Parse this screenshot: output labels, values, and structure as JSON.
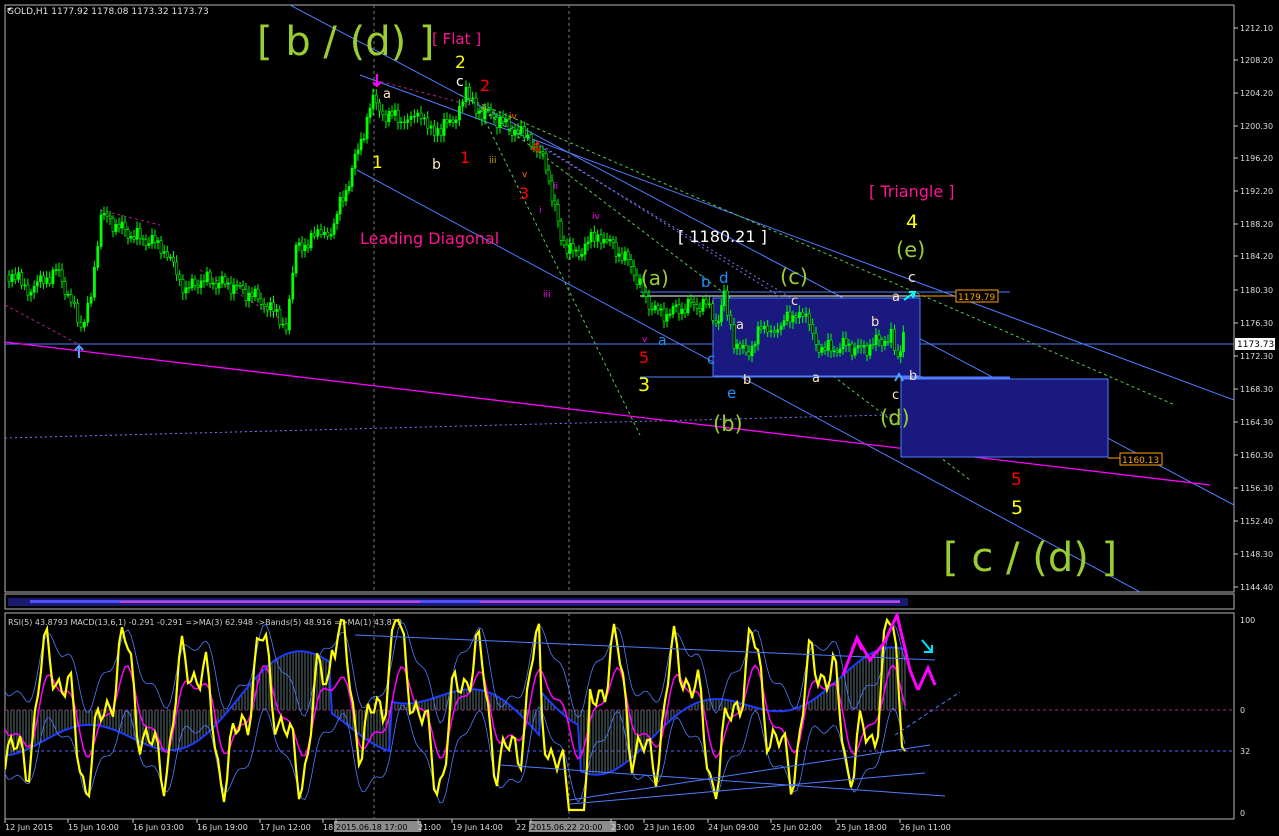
{
  "window": {
    "symbol_line": "GOLD,H1  1177.92 1178.08 1173.32 1173.73"
  },
  "indicator_header": "RSI(5) 43.8793  MACD(13,6,1) -0.291 -0.291  =>MA(3) 62.948  ->Bands(5) 48.916  =>MA(1) 43.879",
  "price_axis": {
    "ticks": [
      "1212.10",
      "1208.20",
      "1204.20",
      "1200.30",
      "1196.20",
      "1192.20",
      "1188.20",
      "1184.20",
      "1180.30",
      "1176.30",
      "1172.30",
      "1168.30",
      "1164.30",
      "1160.30",
      "1156.30",
      "1152.40",
      "1148.30",
      "1144.40"
    ],
    "current_price": "1173.73",
    "level_1179": "1179.79",
    "level_1160": "1160.13"
  },
  "indicator_axis": {
    "ticks": [
      "100",
      "0",
      "32",
      "0"
    ]
  },
  "time_axis": {
    "labels": [
      "12 Jun 2015",
      "15 Jun 10:00",
      "16 Jun 03:00",
      "16 Jun 19:00",
      "17 Jun 12:00",
      "18 Jun 05:00",
      "2015.06.18 17:00",
      "21:00",
      "19 Jun 14:00",
      "22 Jun 07:00",
      "2015.06.22 20:00",
      "23:00",
      "23 Jun 16:00",
      "24 Jun 09:00",
      "25 Jun 02:00",
      "25 Jun 18:00",
      "26 Jun 11:00"
    ]
  },
  "wave_labels": {
    "b_d": "[ b / (d) ]",
    "flat": "[ Flat ]",
    "wave2_yellow": "2",
    "c_top": "c",
    "wave2_red": "2",
    "a_top": "a",
    "one_yellow": "1",
    "b_low": "b",
    "one_red": "1",
    "ii": "ii",
    "iii_a": "iii",
    "iv_a": "iv",
    "four_red": "4",
    "v_a": "v",
    "three_red": "3",
    "i_a": "i",
    "ii_b": "ii",
    "iv_b": "iv",
    "iii_b": "iii",
    "leading_diagonal": "Leading Diagonal",
    "value_1180": "[ 1180.21 ]",
    "a_paren": "(a)",
    "v_b": "v",
    "five_red": "5",
    "three_yellow": "3",
    "a_cyan": "a",
    "b_cyan": "b",
    "d_cyan": "d",
    "c_cyan": "c",
    "e_cyan": "e",
    "a_white": "a",
    "b_white": "b",
    "b_paren": "(b)",
    "c_paren": "(c)",
    "c_white": "c",
    "a_white2": "a",
    "b_white2": "b",
    "triangle": "[ Triangle ]",
    "four_yellow": "4",
    "e_paren": "(e)",
    "c_white2": "c",
    "a_white3": "a",
    "b_white3": "b",
    "c_white3": "c",
    "d_paren": "(d)",
    "five_red_b": "5",
    "five_yellow": "5",
    "c_d": "[ c / (d) ]"
  },
  "colors": {
    "background": "#000000",
    "candles": "#00ff00",
    "channel_lines": "#4f7bff",
    "magenta_trendline": "#ff00ff",
    "wave_green": "#9acd32",
    "wave_yellow": "#ffff00",
    "wave_red": "#ff0000",
    "wave_pink": "#ff1493",
    "wave_cyan": "#1e90ff",
    "rsi": "#ffff00",
    "ma": "#ff00ff",
    "macd_hist": "#2f4f4f"
  }
}
